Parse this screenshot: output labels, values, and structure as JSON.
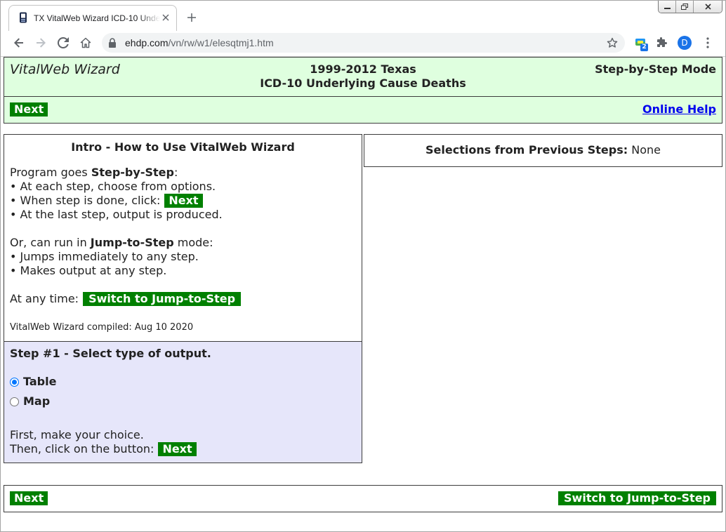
{
  "colors": {
    "button_green": "#008000",
    "header_bg": "#dfffdf",
    "step_bg": "#e6e6fa",
    "link_blue": "#0000ee",
    "profile_blue": "#1a73e8",
    "radio_blue": "#0075ff"
  },
  "icons": [
    "favicon-icon",
    "tab-close-icon",
    "new-tab-icon",
    "minimize-icon",
    "restore-icon",
    "window-close-icon",
    "back-arrow-icon",
    "forward-arrow-icon",
    "reload-icon",
    "home-icon",
    "lock-icon",
    "star-icon",
    "extension-icon",
    "puzzle-icon",
    "menu-dots-icon"
  ],
  "browser": {
    "tab_title": "TX VitalWeb Wizard ICD-10 Unde",
    "url_host": "ehdp.com",
    "url_path": "/vn/rw/w1/elesqtmj1.htm",
    "extension_badge": "2",
    "profile_initial": "D"
  },
  "header": {
    "app_name": "VitalWeb Wizard",
    "title_line1": "1999-2012 Texas",
    "title_line2": "ICD-10 Underlying Cause Deaths",
    "mode": "Step-by-Step Mode",
    "next_button": "Next",
    "help_link": "Online Help"
  },
  "intro": {
    "heading": "Intro - How to Use VitalWeb Wizard",
    "program_pre": "Program goes ",
    "program_bold": "Step-by-Step",
    "program_post": ":",
    "bullet1": "• At each step, choose from options.",
    "bullet2": "• When step is done, click:",
    "bullet2_button": "Next",
    "bullet3": "• At the last step, output is produced.",
    "jump_pre": "Or, can run in ",
    "jump_bold": "Jump-to-Step",
    "jump_post": " mode:",
    "bullet4": "• Jumps immediately to any step.",
    "bullet5": "• Makes output at any step.",
    "anytime_label": "At any time:",
    "switch_button": "Switch to Jump-to-Step",
    "compiled": "VitalWeb Wizard compiled: Aug 10 2020"
  },
  "step": {
    "heading": "Step #1 - Select type of output.",
    "options": [
      {
        "label": "Table",
        "checked": true
      },
      {
        "label": "Map",
        "checked": false
      }
    ],
    "instruction1": "First, make your choice.",
    "instruction2": "Then, click on the button:",
    "next_button": "Next"
  },
  "selections": {
    "label": "Selections from Previous Steps:",
    "value": "None"
  },
  "footer": {
    "next_button": "Next",
    "switch_button": "Switch to Jump-to-Step"
  }
}
